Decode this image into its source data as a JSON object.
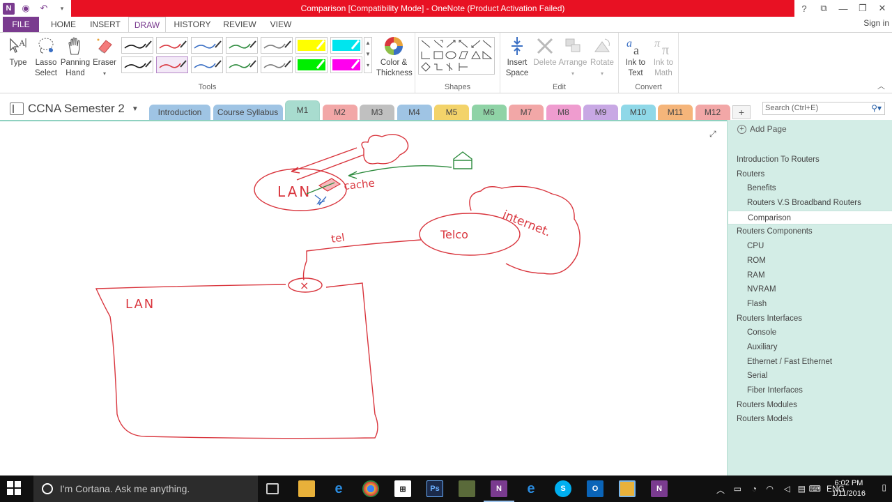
{
  "window": {
    "title": "Comparison [Compatibility Mode] -  OneNote (Product Activation Failed)",
    "controls": [
      "?",
      "⧉",
      "—",
      "❐",
      "✕"
    ]
  },
  "ribbon_tabs": {
    "file": "FILE",
    "tabs": [
      "HOME",
      "INSERT",
      "DRAW",
      "HISTORY",
      "REVIEW",
      "VIEW"
    ],
    "active": "DRAW",
    "sign_in": "Sign in"
  },
  "ribbon": {
    "type": "Type",
    "lasso": "Lasso Select",
    "panning": "Panning Hand",
    "eraser": "Eraser",
    "color_thickness": "Color & Thickness",
    "insert_space": "Insert Space",
    "delete": "Delete",
    "arrange": "Arrange",
    "rotate": "Rotate",
    "ink_to_text": "Ink to Text",
    "ink_to_math": "Ink to Math",
    "group_tools": "Tools",
    "group_shapes": "Shapes",
    "group_edit": "Edit",
    "group_convert": "Convert",
    "pens": [
      {
        "color": "#111111",
        "kind": "pen"
      },
      {
        "color": "#d9363e",
        "kind": "pen"
      },
      {
        "color": "#3a6fc4",
        "kind": "pen"
      },
      {
        "color": "#2e8b3e",
        "kind": "pen"
      },
      {
        "color": "#7a7a7a",
        "kind": "pen"
      },
      {
        "color": "#ffff00",
        "kind": "highlighter"
      },
      {
        "color": "#00e5ee",
        "kind": "highlighter"
      },
      {
        "color": "#111111",
        "kind": "pen"
      },
      {
        "color": "#d9363e",
        "kind": "pen"
      },
      {
        "color": "#3a6fc4",
        "kind": "pen"
      },
      {
        "color": "#2e8b3e",
        "kind": "pen"
      },
      {
        "color": "#7a7a7a",
        "kind": "pen"
      },
      {
        "color": "#00ee00",
        "kind": "highlighter"
      },
      {
        "color": "#ff00ee",
        "kind": "highlighter"
      }
    ]
  },
  "notebook": {
    "name": "CCNA Semester 2",
    "sections": [
      {
        "label": "Introduction",
        "color": "#9fc4e4"
      },
      {
        "label": "Course Syllabus",
        "color": "#9fc4e4"
      },
      {
        "label": "M1",
        "color": "#a8dccf"
      },
      {
        "label": "M2",
        "color": "#f2a7a7"
      },
      {
        "label": "M3",
        "color": "#c0c0c0"
      },
      {
        "label": "M4",
        "color": "#9fc4e4"
      },
      {
        "label": "M5",
        "color": "#f3d36a"
      },
      {
        "label": "M6",
        "color": "#8fd3a6"
      },
      {
        "label": "M7",
        "color": "#f2a7a7"
      },
      {
        "label": "M8",
        "color": "#ef9ccf"
      },
      {
        "label": "M9",
        "color": "#c8a8e4"
      },
      {
        "label": "M10",
        "color": "#8fd8e8"
      },
      {
        "label": "M11",
        "color": "#f5b57a"
      },
      {
        "label": "M12",
        "color": "#f2a7a7"
      }
    ],
    "active_section": "M1",
    "add_tab": "+",
    "search_placeholder": "Search (Ctrl+E)"
  },
  "pages": {
    "add_page": "Add Page",
    "items": [
      {
        "label": "Introduction To Routers",
        "level": 0
      },
      {
        "label": "Routers",
        "level": 0
      },
      {
        "label": "Benefits",
        "level": 1
      },
      {
        "label": "Routers V.S Broadband Routers",
        "level": 1
      },
      {
        "label": "Comparison",
        "level": 1,
        "selected": true
      },
      {
        "label": "Routers Components",
        "level": 0
      },
      {
        "label": "CPU",
        "level": 1
      },
      {
        "label": "ROM",
        "level": 1
      },
      {
        "label": "RAM",
        "level": 1
      },
      {
        "label": "NVRAM",
        "level": 1
      },
      {
        "label": "Flash",
        "level": 1
      },
      {
        "label": "Routers Interfaces",
        "level": 0
      },
      {
        "label": "Console",
        "level": 1
      },
      {
        "label": "Auxiliary",
        "level": 1
      },
      {
        "label": "Ethernet / Fast Ethernet",
        "level": 1
      },
      {
        "label": "Serial",
        "level": 1
      },
      {
        "label": "Fiber Interfaces",
        "level": 1
      },
      {
        "label": "Routers Modules",
        "level": 0
      },
      {
        "label": "Routers Models",
        "level": 0
      }
    ]
  },
  "ink": {
    "lan_top": "LAN",
    "cache": "cache",
    "telco": "Telco",
    "internet": "internet.",
    "tel": "tel",
    "x_mark": "×",
    "lan_bottom": "LAN"
  },
  "taskbar": {
    "cortana": "I'm Cortana. Ask me anything.",
    "language": "ENG",
    "time": "6:02 PM",
    "date": "1/11/2016"
  }
}
